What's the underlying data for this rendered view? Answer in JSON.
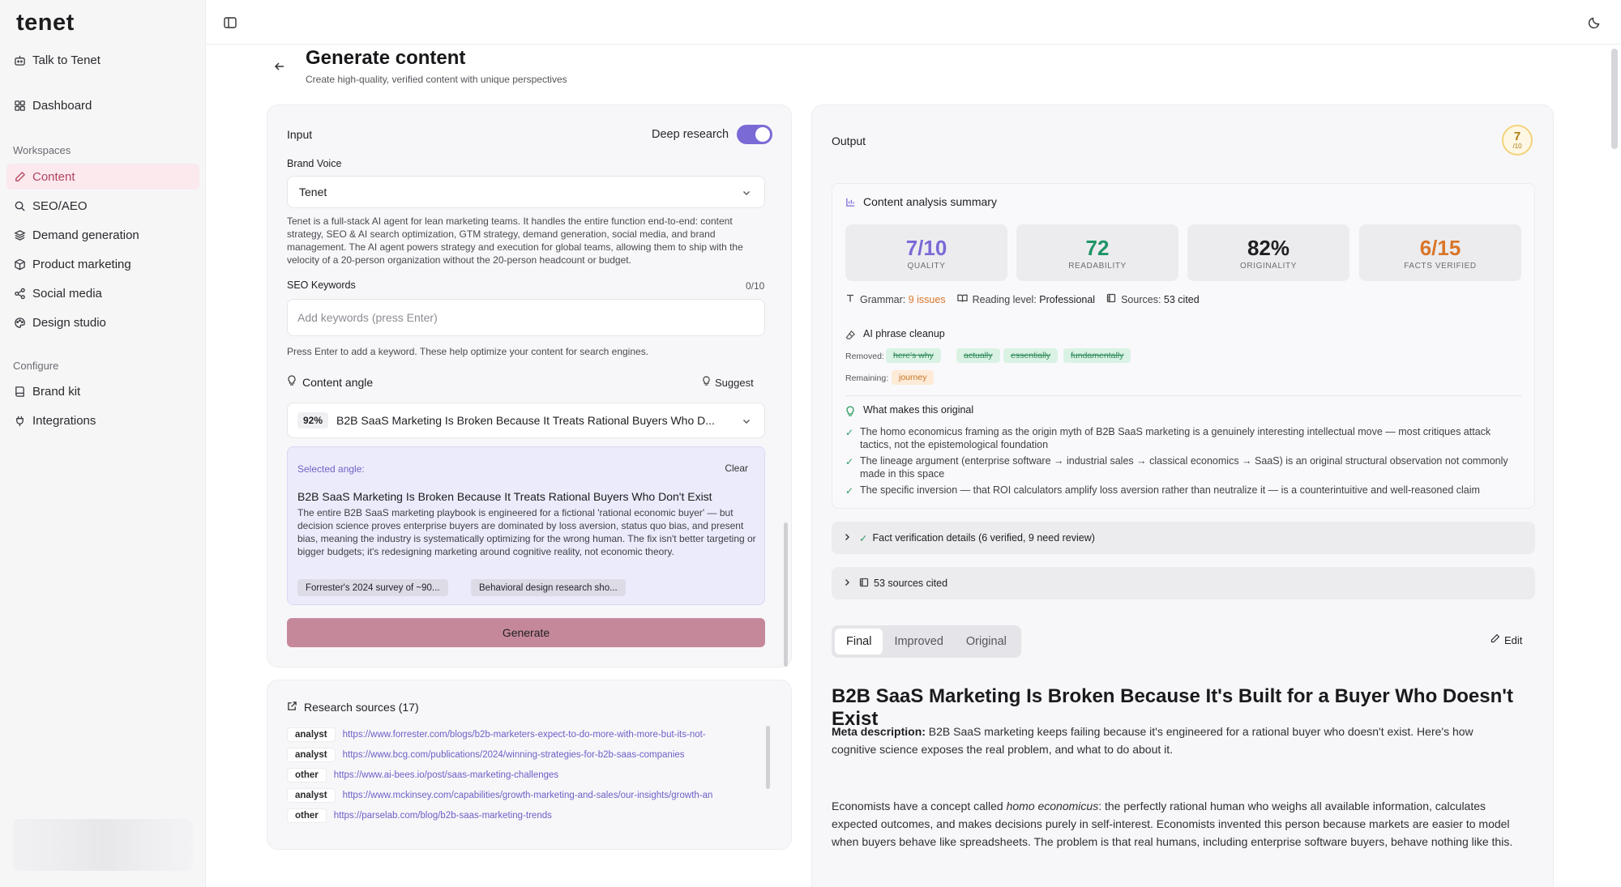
{
  "app": {
    "logo": "tenet"
  },
  "sidebar": {
    "top_items": [
      {
        "label": "Talk to Tenet",
        "icon": "bot-icon"
      },
      {
        "label": "Dashboard",
        "icon": "grid-icon"
      }
    ],
    "workspaces_label": "Workspaces",
    "workspaces": [
      {
        "label": "Content",
        "icon": "pencil-icon",
        "active": true
      },
      {
        "label": "SEO/AEO",
        "icon": "search-icon"
      },
      {
        "label": "Demand generation",
        "icon": "layers-icon"
      },
      {
        "label": "Product marketing",
        "icon": "box-icon"
      },
      {
        "label": "Social media",
        "icon": "share-icon"
      },
      {
        "label": "Design studio",
        "icon": "palette-icon"
      }
    ],
    "configure_label": "Configure",
    "configure": [
      {
        "label": "Brand kit",
        "icon": "book-icon"
      },
      {
        "label": "Integrations",
        "icon": "plug-icon"
      }
    ]
  },
  "header": {
    "title": "Generate content",
    "subtitle": "Create high-quality, verified content with unique perspectives"
  },
  "input": {
    "title": "Input",
    "deep_research_label": "Deep research",
    "deep_research_on": true,
    "brand_voice_label": "Brand Voice",
    "brand_voice_value": "Tenet",
    "brand_voice_desc": "Tenet is a full-stack AI agent for lean marketing teams. It handles the entire function end-to-end: content strategy, SEO & AI search optimization, GTM strategy, demand generation, social media, and brand management. The AI agent powers strategy and execution for global teams, allowing them to ship with the velocity of a 20-person organization without the 20-person headcount or budget.",
    "seo_label": "SEO Keywords",
    "seo_counter": "0/10",
    "seo_placeholder": "Add keywords (press Enter)",
    "seo_help": "Press Enter to add a keyword. These help optimize your content for search engines.",
    "angle_label": "Content angle",
    "suggest_label": "Suggest",
    "angle_score": "92%",
    "angle_select_text": "B2B SaaS Marketing Is Broken Because It Treats Rational Buyers Who D...",
    "selected_label": "Selected angle:",
    "clear_label": "Clear",
    "selected_title": "B2B SaaS Marketing Is Broken Because It Treats Rational Buyers Who Don't Exist",
    "selected_body": "The entire B2B SaaS marketing playbook is engineered for a fictional 'rational economic buyer' — but decision science proves enterprise buyers are dominated by loss aversion, status quo bias, and present bias, meaning the industry is systematically optimizing for the wrong human. The fix isn't better targeting or bigger budgets; it's redesigning marketing around cognitive reality, not economic theory.",
    "chips": [
      "Forrester's 2024 survey of ~90...",
      "Behavioral design research sho..."
    ],
    "generate_label": "Generate"
  },
  "research": {
    "title": "Research sources (17)",
    "sources": [
      {
        "tag": "analyst",
        "url": "https://www.forrester.com/blogs/b2b-marketers-expect-to-do-more-with-more-but-its-not-"
      },
      {
        "tag": "analyst",
        "url": "https://www.bcg.com/publications/2024/winning-strategies-for-b2b-saas-companies"
      },
      {
        "tag": "other",
        "url": "https://www.ai-bees.io/post/saas-marketing-challenges"
      },
      {
        "tag": "analyst",
        "url": "https://www.mckinsey.com/capabilities/growth-marketing-and-sales/our-insights/growth-an"
      },
      {
        "tag": "other",
        "url": "https://parselab.com/blog/b2b-saas-marketing-trends"
      }
    ]
  },
  "output": {
    "title": "Output",
    "score": "7",
    "score_denom": "/10",
    "summary_title": "Content analysis summary",
    "metrics": [
      {
        "value": "7/10",
        "label": "QUALITY",
        "color": "#7a6ad6"
      },
      {
        "value": "72",
        "label": "READABILITY",
        "color": "#1f9466"
      },
      {
        "value": "82%",
        "label": "ORIGINALITY",
        "color": "#1f1f23"
      },
      {
        "value": "6/15",
        "label": "FACTS VERIFIED",
        "color": "#d9762a"
      }
    ],
    "grammar_label": "Grammar:",
    "grammar_value": "9 issues",
    "reading_label": "Reading level:",
    "reading_value": "Professional",
    "sources_label": "Sources:",
    "sources_value": "53 cited",
    "cleanup_title": "AI phrase cleanup",
    "removed_label": "Removed:",
    "removed": [
      "here's why",
      "actually",
      "essentially",
      "fundamentally"
    ],
    "remaining_label": "Remaining:",
    "remaining": [
      "journey"
    ],
    "original_title": "What makes this original",
    "original_items": [
      "The homo economicus framing as the origin myth of B2B SaaS marketing is a genuinely interesting intellectual move — most critiques attack tactics, not the epistemological foundation",
      "The lineage argument (enterprise software → industrial sales → classical economics → SaaS) is an original structural observation not commonly made in this space",
      "The specific inversion — that ROI calculators amplify loss aversion rather than neutralize it — is a counterintuitive and well-reasoned claim"
    ],
    "fact_details": "Fact verification details (6 verified, 9 need review)",
    "sources_cited": "53 sources cited",
    "tabs": [
      "Final",
      "Improved",
      "Original"
    ],
    "edit_label": "Edit",
    "article_title": "B2B SaaS Marketing Is Broken Because It's Built for a Buyer Who Doesn't Exist",
    "meta_label": "Meta description:",
    "meta_text": "B2B SaaS marketing keeps failing because it's engineered for a rational buyer who doesn't exist. Here's how cognitive science exposes the real problem, and what to do about it.",
    "para_before": "Economists have a concept called ",
    "para_em": "homo economicus",
    "para_after": ": the perfectly rational human who weighs all available information, calculates expected outcomes, and makes decisions purely in self-interest. Economists invented this person because markets are easier to model when buyers behave like spreadsheets. The problem is that real humans, including enterprise software buyers, behave nothing like this."
  }
}
